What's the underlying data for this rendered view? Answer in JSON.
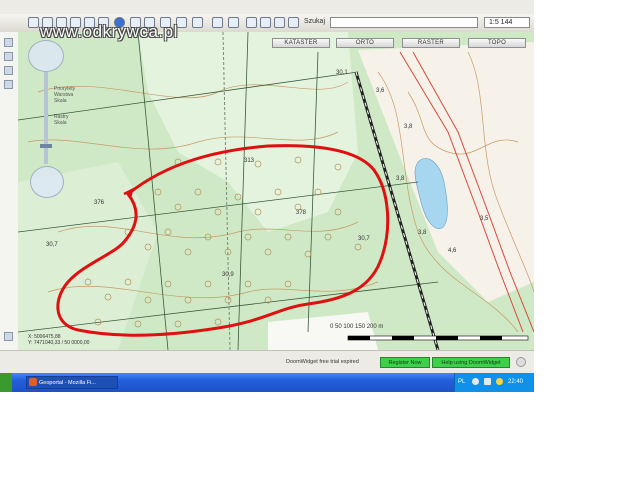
{
  "watermark": "www.odkrywca.pl",
  "toolbar": {
    "search_label": "Szukaj",
    "scale_value": "1:5 144",
    "icons": [
      "back-icon",
      "forward-icon",
      "zoom-in-icon",
      "zoom-out-icon",
      "pan-icon",
      "extent-icon",
      "info-icon",
      "select-icon",
      "measure-icon",
      "edit-icon",
      "print-icon",
      "save-icon",
      "settings-icon"
    ]
  },
  "layer_buttons": [
    "KATASTER",
    "ORTO",
    "RASTER",
    "TOPO"
  ],
  "map": {
    "labels": [
      "30,1",
      "313",
      "376",
      "378",
      "30,7",
      "30,9",
      "30,7",
      "3,6",
      "3,8",
      "3,5",
      "4,6",
      "3,8",
      "3,8"
    ],
    "scale_text": "0 50 100 150 200 m",
    "coord_lines": [
      "X: 5006475,88",
      "Y: 7471040,33 / 50 0000,00"
    ]
  },
  "nav_legend": [
    "Priorytety",
    "Warstwa",
    "Skala",
    "Rastry",
    "Skala"
  ],
  "status": {
    "message": "DoomWidget free trial expired",
    "register_label": "Register Now",
    "help_label": "Help using DoomWidget"
  },
  "taskbar": {
    "task_label": "Geoportal - Mozilla Fi...",
    "language": "PL",
    "clock": "22:40"
  },
  "colors": {
    "map_green": "#cfe9c6",
    "annotation_red": "#e01010",
    "register_green": "#3ed04a",
    "taskbar_blue": "#245edb"
  }
}
